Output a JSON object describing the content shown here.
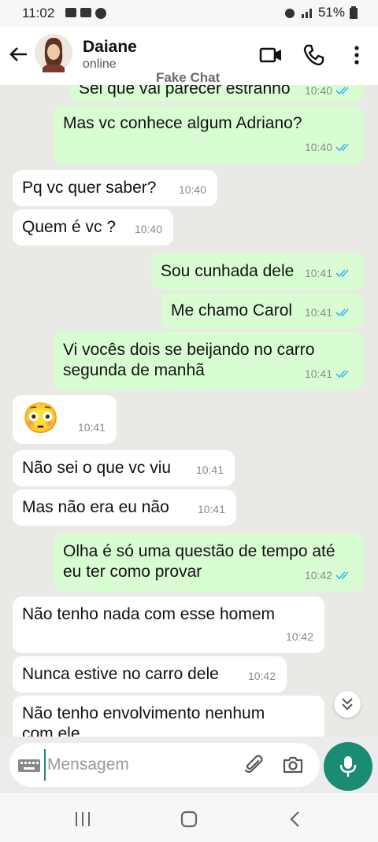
{
  "status": {
    "time": "11:02",
    "battery": "51%"
  },
  "header": {
    "name": "Daiane",
    "presence": "online",
    "watermark": "Fake Chat"
  },
  "messages": [
    {
      "dir": "out",
      "text": "Sei que vai parecer estranho",
      "time": "10:40"
    },
    {
      "dir": "out",
      "text": "Mas vc conhece algum Adriano?",
      "time": "10:40"
    },
    {
      "dir": "in",
      "text": "Pq vc quer saber?",
      "time": "10:40"
    },
    {
      "dir": "in",
      "text": "Quem é vc ?",
      "time": "10:40"
    },
    {
      "dir": "out",
      "text": "Sou cunhada dele",
      "time": "10:41"
    },
    {
      "dir": "out",
      "text": "Me chamo Carol",
      "time": "10:41"
    },
    {
      "dir": "out",
      "text": "Vi vocês dois se beijando no carro\nsegunda de manhã",
      "time": "10:41"
    },
    {
      "dir": "in",
      "text": "😳",
      "time": "10:41"
    },
    {
      "dir": "in",
      "text": "Não sei o que vc viu",
      "time": "10:41"
    },
    {
      "dir": "in",
      "text": "Mas não era eu não",
      "time": "10:41"
    },
    {
      "dir": "out",
      "text": "Olha é só uma questão de tempo até\neu ter como provar",
      "time": "10:42"
    },
    {
      "dir": "in",
      "text": "Não tenho nada com esse homem",
      "time": "10:42"
    },
    {
      "dir": "in",
      "text": "Nunca estive no carro dele",
      "time": "10:42"
    },
    {
      "dir": "in",
      "text": "Não tenho envolvimento nenhum\ncom ele",
      "time": ""
    }
  ],
  "composer": {
    "placeholder": "Mensagem"
  },
  "colors": {
    "accent": "#1a8b74",
    "outgoing": "#d9fdd3",
    "incoming": "#ffffff",
    "read_ticks": "#34b7f1"
  },
  "icons": {
    "back": "arrow-left-icon",
    "video": "video-camera-icon",
    "call": "phone-icon",
    "menu": "more-vertical-icon",
    "attach": "paperclip-icon",
    "camera": "camera-icon",
    "mic": "microphone-icon",
    "keyboard": "keyboard-icon"
  }
}
